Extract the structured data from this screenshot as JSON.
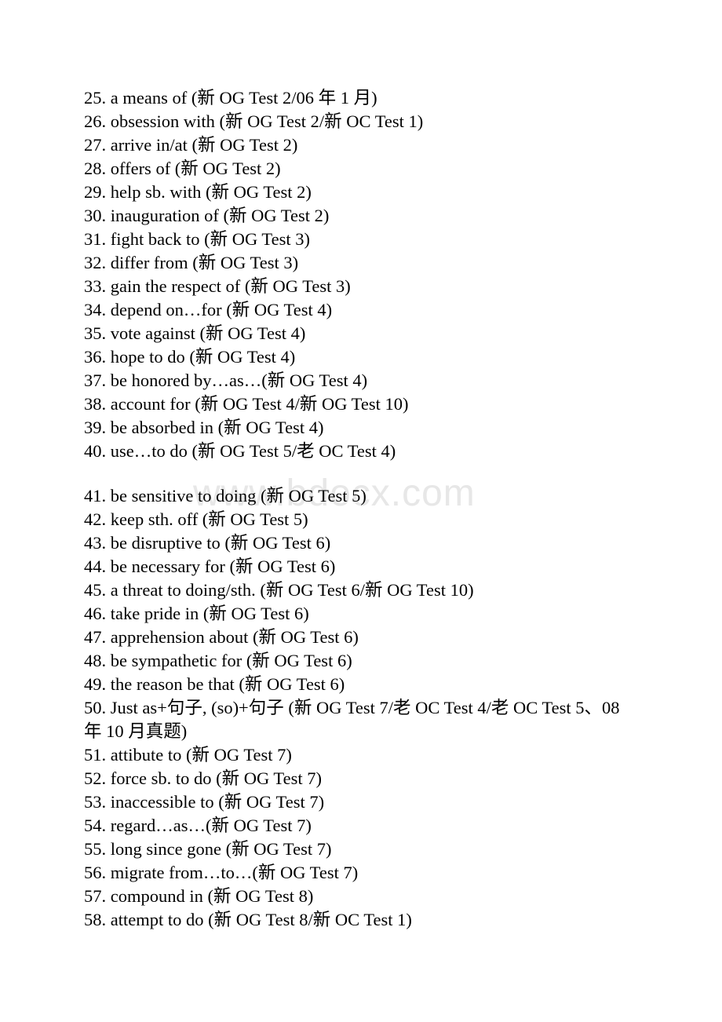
{
  "document": {
    "background_color": "#ffffff",
    "text_color": "#000000",
    "watermark": {
      "text": "www.bdocx.com",
      "color": "#e7e7e7"
    },
    "entries": [
      {
        "num": "25.",
        "text": "25. a means of (新 OG Test 2/06 年 1 月)",
        "gap_before": false
      },
      {
        "num": "26.",
        "text": "26. obsession with (新 OG Test 2/新 OC Test 1)",
        "gap_before": false
      },
      {
        "num": "27.",
        "text": "27. arrive in/at (新 OG Test 2)",
        "gap_before": false
      },
      {
        "num": "28.",
        "text": "28. offers of (新 OG Test 2)",
        "gap_before": false
      },
      {
        "num": "29.",
        "text": "29. help sb. with (新 OG Test 2)",
        "gap_before": false
      },
      {
        "num": "30.",
        "text": "30. inauguration of (新 OG Test 2)",
        "gap_before": false
      },
      {
        "num": "31.",
        "text": "31. fight back to (新 OG Test 3)",
        "gap_before": false
      },
      {
        "num": "32.",
        "text": "32. differ from (新 OG Test 3)",
        "gap_before": false
      },
      {
        "num": "33.",
        "text": "33. gain the respect of (新 OG Test 3)",
        "gap_before": false
      },
      {
        "num": "34.",
        "text": "34. depend on…for (新 OG Test 4)",
        "gap_before": false
      },
      {
        "num": "35.",
        "text": "35. vote against (新 OG Test 4)",
        "gap_before": false
      },
      {
        "num": "36.",
        "text": "36. hope to do (新 OG Test 4)",
        "gap_before": false
      },
      {
        "num": "37.",
        "text": "37. be honored by…as…(新 OG Test 4)",
        "gap_before": false
      },
      {
        "num": "38.",
        "text": "38. account for (新 OG Test 4/新 OG Test 10)",
        "gap_before": false
      },
      {
        "num": "39.",
        "text": "39. be absorbed in (新 OG Test 4)",
        "gap_before": false
      },
      {
        "num": "40.",
        "text": "40. use…to do (新 OG Test 5/老 OC Test 4)",
        "gap_before": false
      },
      {
        "num": "41.",
        "text": "41. be sensitive to doing (新 OG Test 5)",
        "gap_before": true
      },
      {
        "num": "42.",
        "text": "42. keep sth. off (新 OG Test 5)",
        "gap_before": false
      },
      {
        "num": "43.",
        "text": "43. be disruptive to (新 OG Test 6)",
        "gap_before": false
      },
      {
        "num": "44.",
        "text": "44. be necessary for (新 OG Test 6)",
        "gap_before": false
      },
      {
        "num": "45.",
        "text": "45. a threat to doing/sth. (新 OG Test 6/新 OG Test 10)",
        "gap_before": false
      },
      {
        "num": "46.",
        "text": "46. take pride in (新 OG Test 6)",
        "gap_before": false
      },
      {
        "num": "47.",
        "text": "47. apprehension about (新 OG Test 6)",
        "gap_before": false
      },
      {
        "num": "48.",
        "text": "48. be sympathetic for (新 OG Test 6)",
        "gap_before": false
      },
      {
        "num": "49.",
        "text": "49. the reason be that (新 OG Test 6)",
        "gap_before": false
      },
      {
        "num": "50.",
        "text": "50. Just as+句子, (so)+句子 (新 OG Test 7/老 OC Test 4/老 OC Test 5、08 年 10 月真题)",
        "gap_before": false
      },
      {
        "num": "51.",
        "text": "51. attibute to (新 OG Test 7)",
        "gap_before": false
      },
      {
        "num": "52.",
        "text": "52. force sb. to do (新 OG Test 7)",
        "gap_before": false
      },
      {
        "num": "53.",
        "text": "53. inaccessible to (新 OG Test 7)",
        "gap_before": false
      },
      {
        "num": "54.",
        "text": "54. regard…as…(新 OG Test 7)",
        "gap_before": false
      },
      {
        "num": "55.",
        "text": "55. long since gone (新 OG Test 7)",
        "gap_before": false
      },
      {
        "num": "56.",
        "text": "56. migrate from…to…(新 OG Test 7)",
        "gap_before": false
      },
      {
        "num": "57.",
        "text": "57. compound in (新 OG Test 8)",
        "gap_before": false
      },
      {
        "num": "58.",
        "text": "58. attempt to do (新 OG Test 8/新 OC Test 1)",
        "gap_before": false
      }
    ]
  }
}
